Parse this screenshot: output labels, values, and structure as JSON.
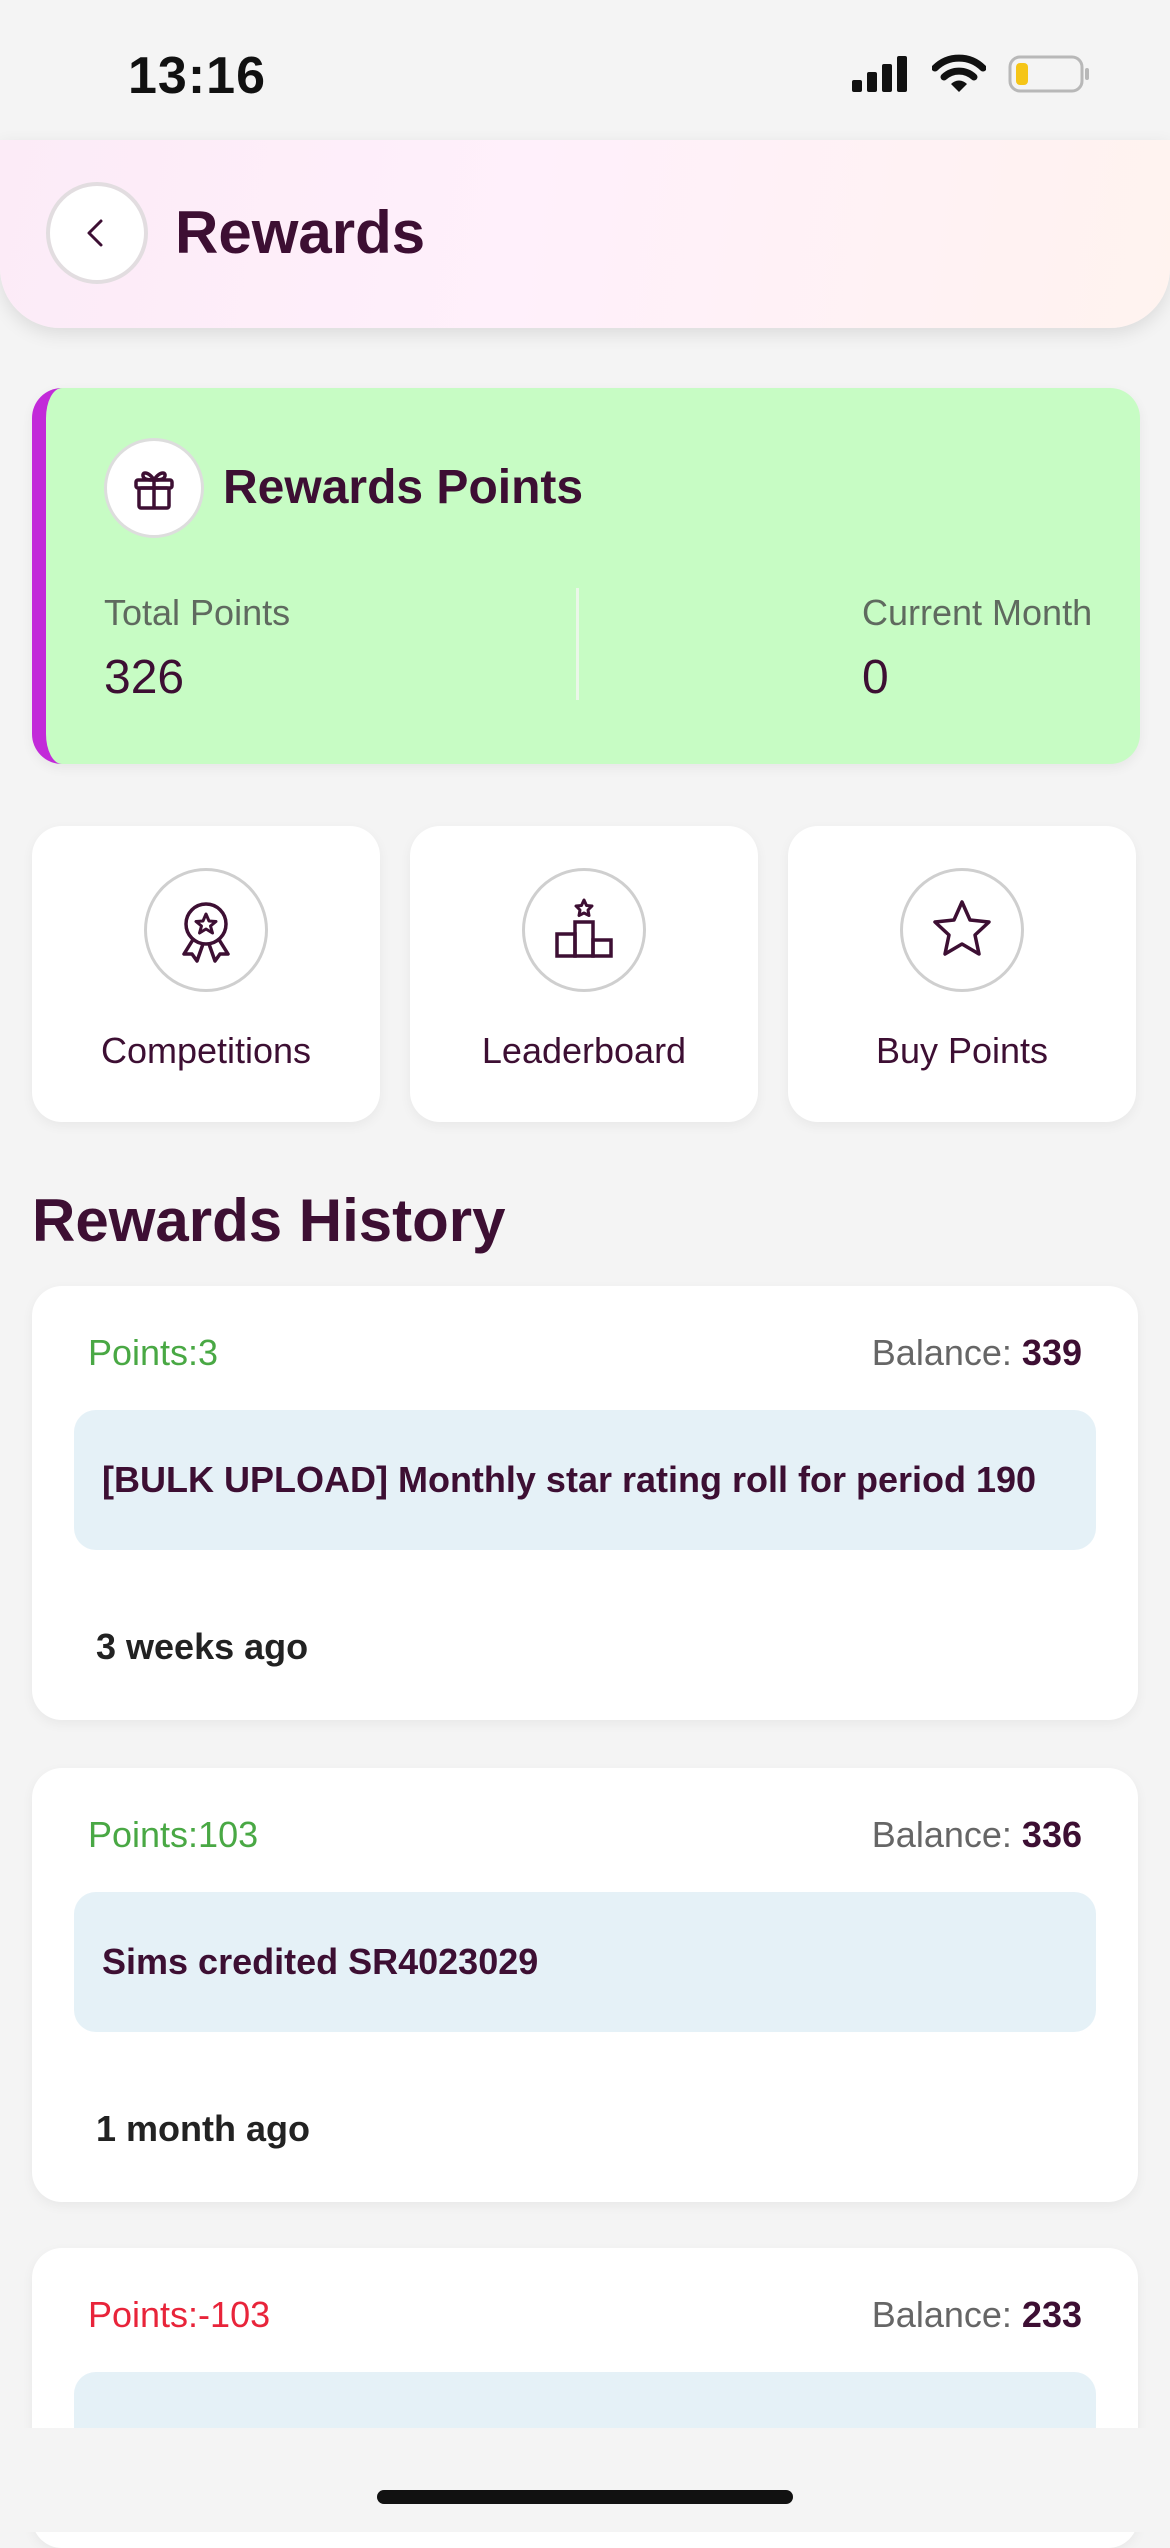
{
  "status_bar": {
    "time": "13:16",
    "icons": [
      "signal-icon",
      "wifi-icon",
      "battery-low-icon"
    ]
  },
  "header": {
    "title": "Rewards",
    "back_icon": "chevron-left-icon"
  },
  "points_card": {
    "icon": "gift-icon",
    "title": "Rewards Points",
    "total_label": "Total Points",
    "total_value": "326",
    "month_label": "Current Month",
    "month_value": "0",
    "accent_color": "#c22ad9",
    "background": "#c7fcc4"
  },
  "actions": [
    {
      "label": "Competitions",
      "icon": "medal-icon"
    },
    {
      "label": "Leaderboard",
      "icon": "podium-icon"
    },
    {
      "label": "Buy Points",
      "icon": "star-icon"
    }
  ],
  "history": {
    "title": "Rewards History",
    "balance_label": "Balance:",
    "items": [
      {
        "points": "Points:3",
        "balance": "339",
        "description": "[BULK UPLOAD] Monthly star rating roll for period 190",
        "time": "3 weeks ago"
      },
      {
        "points": "Points:103",
        "balance": "336",
        "description": "Sims credited SR4023029",
        "time": "1 month ago"
      },
      {
        "points": "Points:-103",
        "balance": "233"
      }
    ]
  }
}
